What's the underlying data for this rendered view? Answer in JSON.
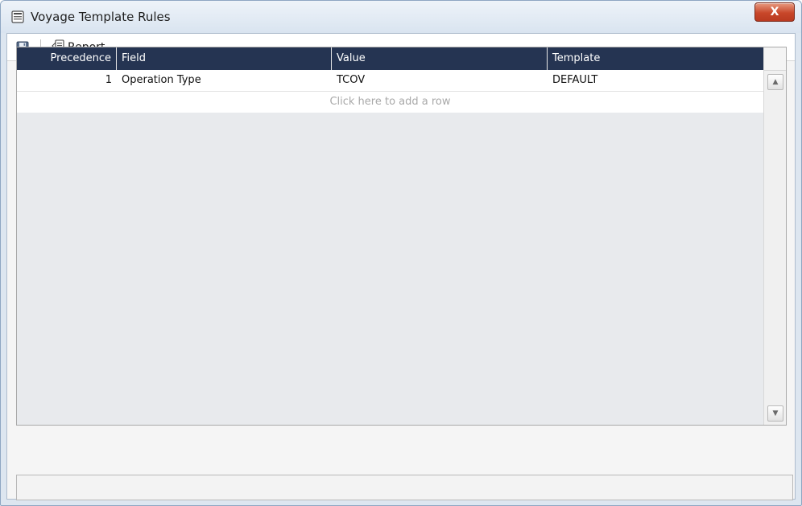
{
  "window": {
    "title": "Voyage Template Rules",
    "close_label": "X"
  },
  "toolbar": {
    "report_label": "Report"
  },
  "grid": {
    "columns": [
      "Precedence",
      "Field",
      "Value",
      "Template"
    ],
    "rows": [
      {
        "precedence": "1",
        "field": "Operation Type",
        "value": "TCOV",
        "template": "DEFAULT"
      }
    ],
    "add_row_label": "Click here to add a row"
  },
  "colors": {
    "header_bg": "#253452",
    "close_button": "#c8472a"
  },
  "icons": [
    "app-window-icon",
    "save-icon",
    "report-icon",
    "scroll-up-icon",
    "scroll-down-icon"
  ]
}
